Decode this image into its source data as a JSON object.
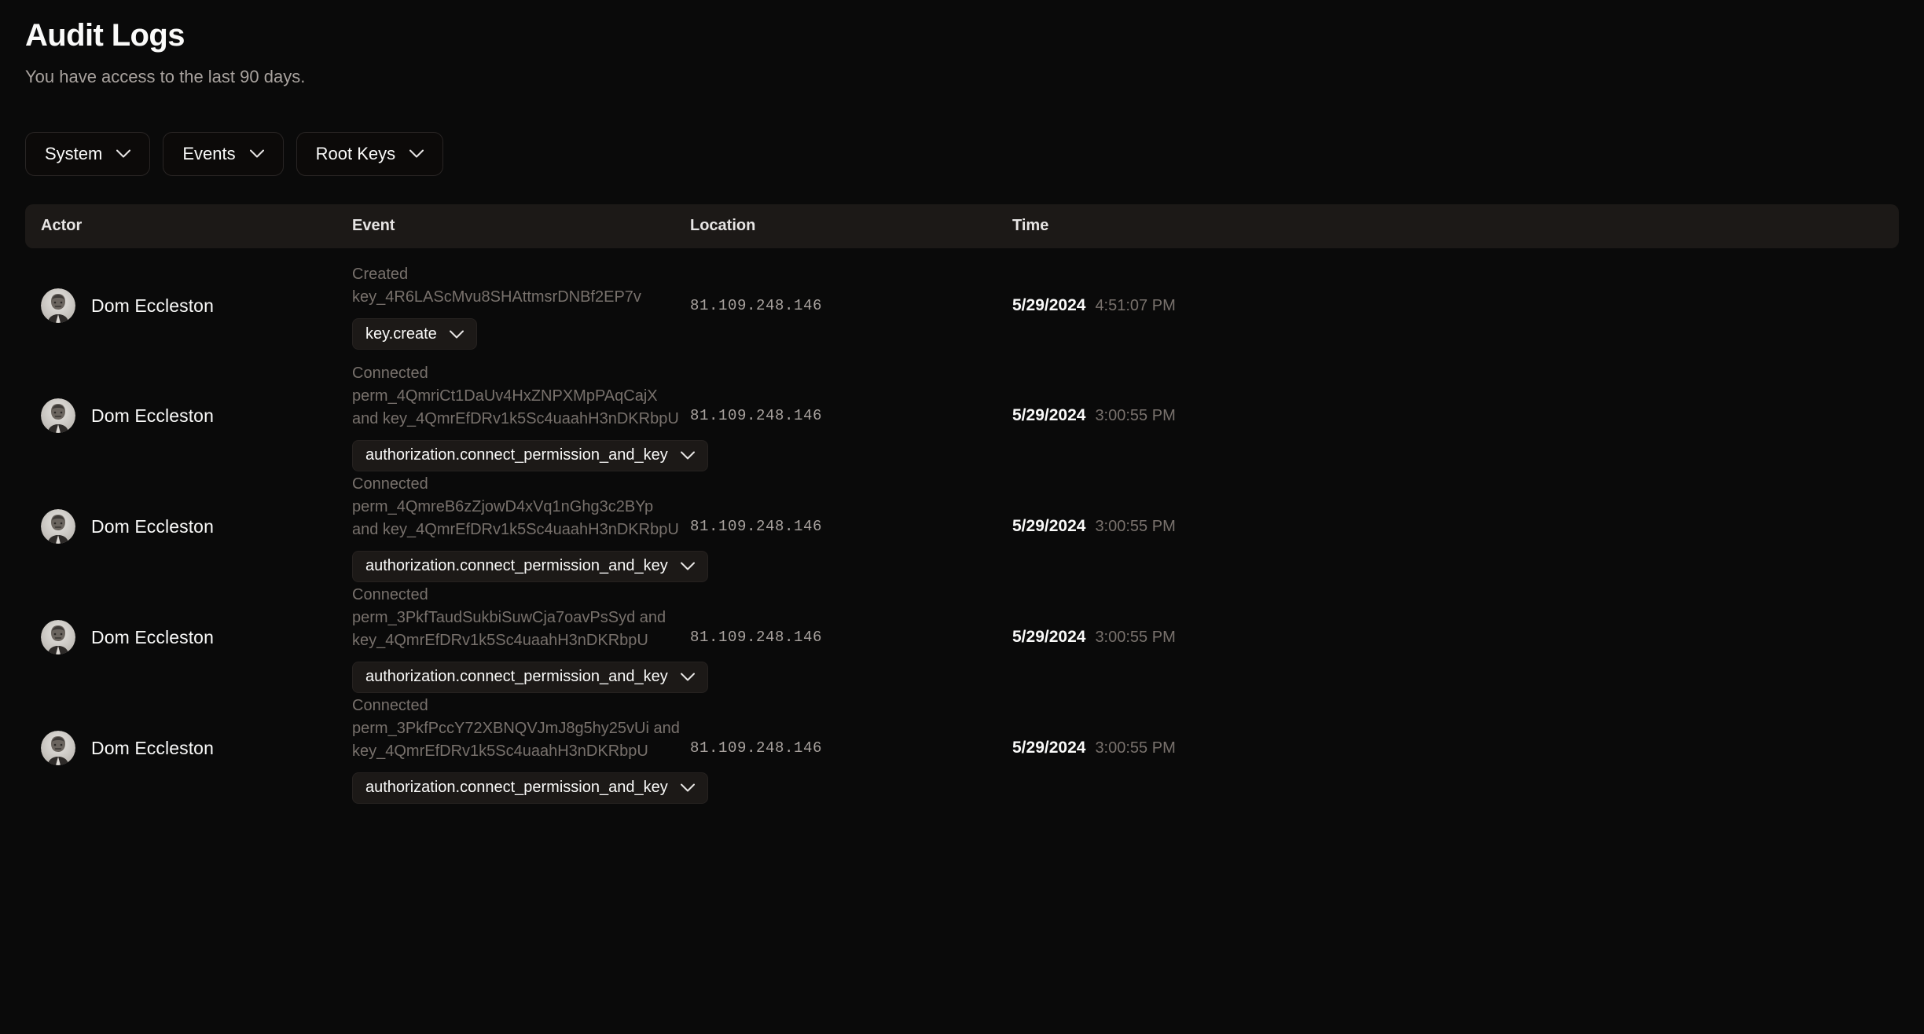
{
  "header": {
    "title": "Audit Logs",
    "subtitle": "You have access to the last 90 days."
  },
  "filters": [
    {
      "label": "System",
      "icon": "chevron-down-icon"
    },
    {
      "label": "Events",
      "icon": "chevron-down-icon"
    },
    {
      "label": "Root Keys",
      "icon": "chevron-down-icon"
    }
  ],
  "table": {
    "columns": [
      {
        "key": "actor",
        "label": "Actor"
      },
      {
        "key": "event",
        "label": "Event"
      },
      {
        "key": "location",
        "label": "Location"
      },
      {
        "key": "time",
        "label": "Time"
      }
    ],
    "rows": [
      {
        "actor": "Dom Eccleston",
        "event_description": "Created key_4R6LAScMvu8SHAttmsrDNBf2EP7v",
        "event_badge": "key.create",
        "location": "81.109.248.146",
        "date": "5/29/2024",
        "time": "4:51:07 PM"
      },
      {
        "actor": "Dom Eccleston",
        "event_description": "Connected perm_4QmriCt1DaUv4HxZNPXMpPAqCajX and key_4QmrEfDRv1k5Sc4uaahH3nDKRbpU",
        "event_badge": "authorization.connect_permission_and_key",
        "location": "81.109.248.146",
        "date": "5/29/2024",
        "time": "3:00:55 PM"
      },
      {
        "actor": "Dom Eccleston",
        "event_description": "Connected perm_4QmreB6zZjowD4xVq1nGhg3c2BYp and key_4QmrEfDRv1k5Sc4uaahH3nDKRbpU",
        "event_badge": "authorization.connect_permission_and_key",
        "location": "81.109.248.146",
        "date": "5/29/2024",
        "time": "3:00:55 PM"
      },
      {
        "actor": "Dom Eccleston",
        "event_description": "Connected perm_3PkfTaudSukbiSuwCja7oavPsSyd and key_4QmrEfDRv1k5Sc4uaahH3nDKRbpU",
        "event_badge": "authorization.connect_permission_and_key",
        "location": "81.109.248.146",
        "date": "5/29/2024",
        "time": "3:00:55 PM"
      },
      {
        "actor": "Dom Eccleston",
        "event_description": "Connected perm_3PkfPccY72XBNQVJmJ8g5hy25vUi and key_4QmrEfDRv1k5Sc4uaahH3nDKRbpU",
        "event_badge": "authorization.connect_permission_and_key",
        "location": "81.109.248.146",
        "date": "5/29/2024",
        "time": "3:00:55 PM"
      }
    ]
  },
  "colors": {
    "page_background": "#0a0a0a",
    "header_row_background": "#1c1917",
    "badge_background": "#1c1917",
    "text_primary": "#fafaf9",
    "text_muted": "#78716c",
    "border": "#292524"
  }
}
